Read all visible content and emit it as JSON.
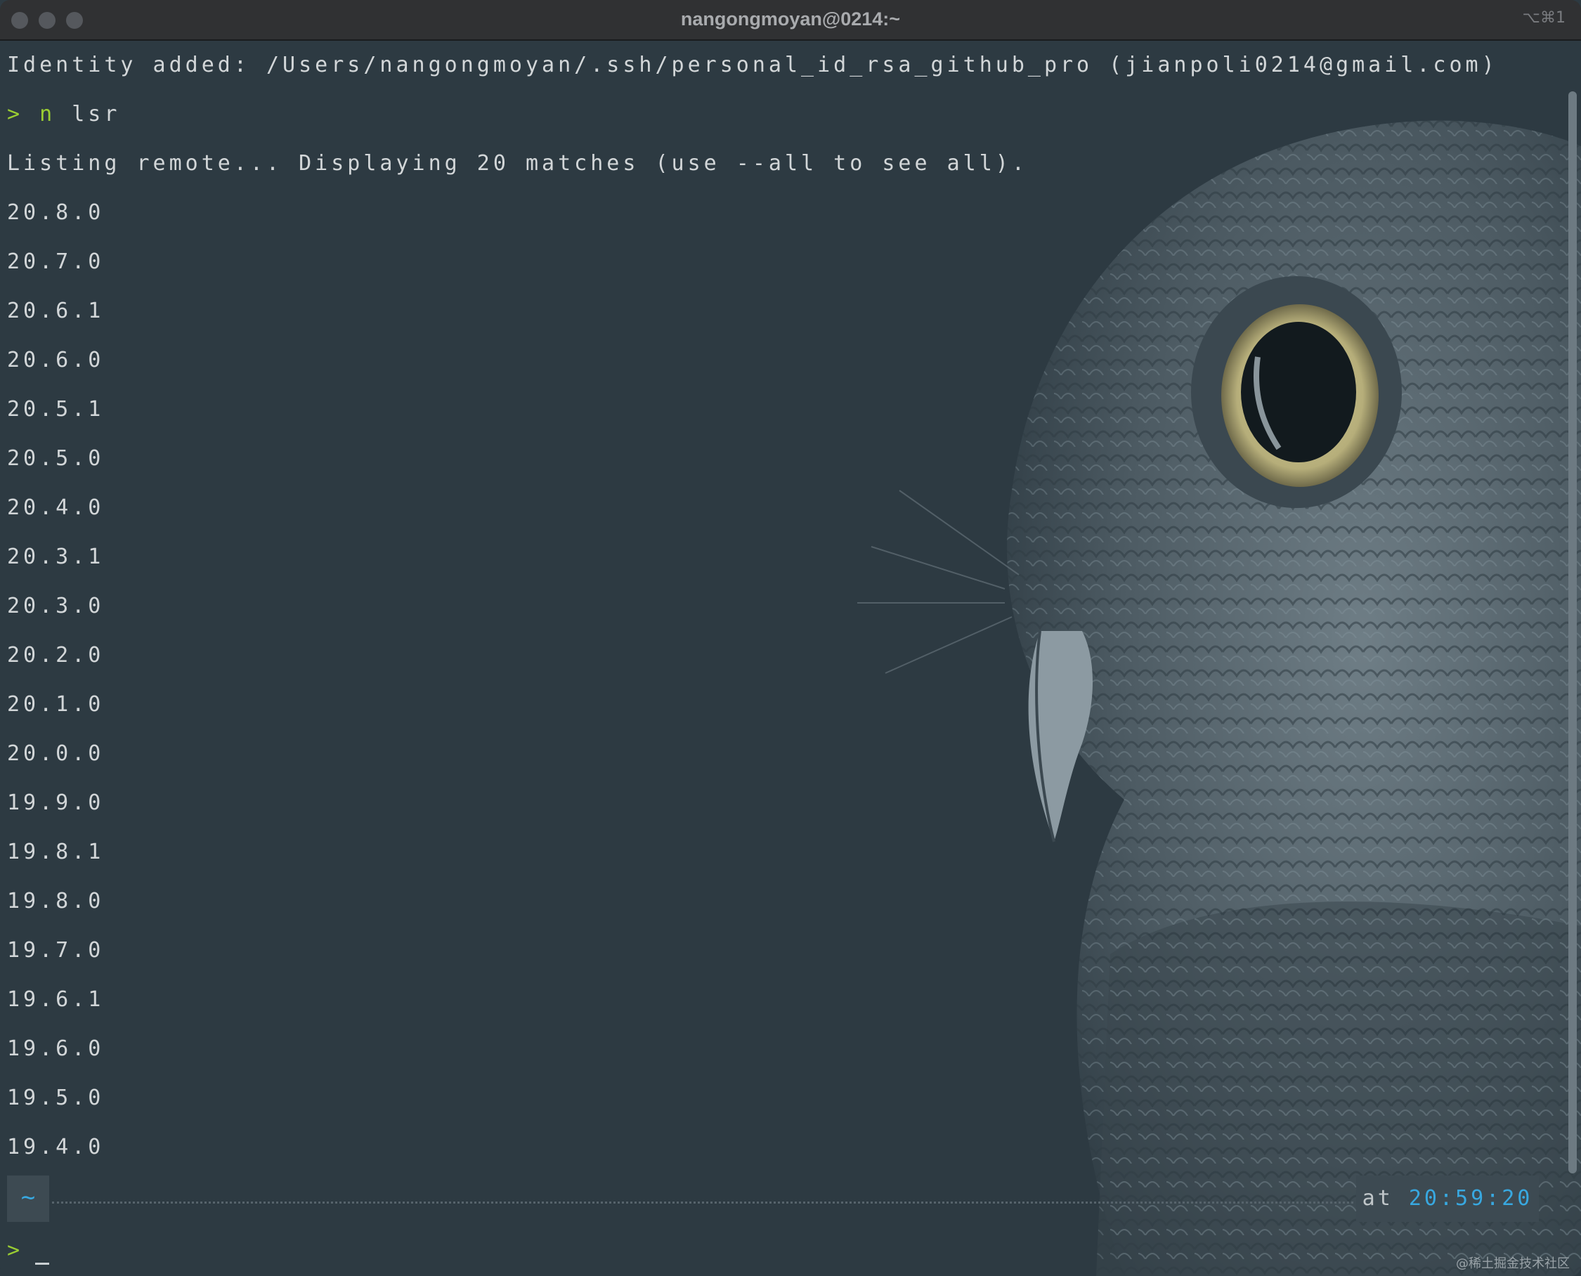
{
  "window": {
    "title": "nangongmoyan@0214:~",
    "shortcut": "⌥⌘1"
  },
  "terminal": {
    "identity_line": "Identity added: /Users/nangongmoyan/.ssh/personal_id_rsa_github_pro (jianpoli0214@gmail.com)",
    "prompt_symbol": ">",
    "command_prefix": "n",
    "command_rest": " lsr",
    "listing_line": "Listing remote... Displaying 20 matches (use --all to see all).",
    "versions": [
      "20.8.0",
      "20.7.0",
      "20.6.1",
      "20.6.0",
      "20.5.1",
      "20.5.0",
      "20.4.0",
      "20.3.1",
      "20.3.0",
      "20.2.0",
      "20.1.0",
      "20.0.0",
      "19.9.0",
      "19.8.1",
      "19.8.0",
      "19.7.0",
      "19.6.1",
      "19.6.0",
      "19.5.0",
      "19.4.0"
    ]
  },
  "statusline": {
    "directory": "~",
    "time_prefix": "at ",
    "time": "20:59:20"
  },
  "final_prompt": {
    "symbol": ">"
  },
  "watermark": "@稀土掘金技术社区",
  "colors": {
    "background": "#2d3a42",
    "text": "#d2d6d8",
    "prompt_green": "#9acd32",
    "accent_blue": "#38a8e0"
  }
}
